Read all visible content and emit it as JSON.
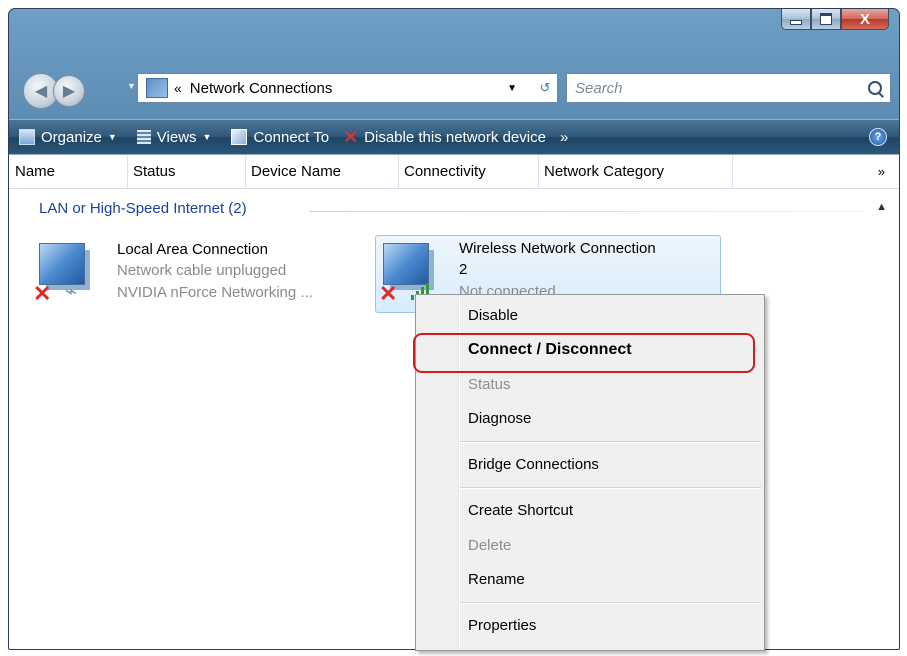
{
  "window": {
    "close_glyph": "X"
  },
  "address_bar": {
    "chevron": "«",
    "path": "Network Connections",
    "search_placeholder": "Search"
  },
  "toolbar": {
    "organize": "Organize",
    "views": "Views",
    "connect_to": "Connect To",
    "disable_device": "Disable this network device",
    "overflow": "»",
    "help": "?"
  },
  "columns": [
    "Name",
    "Status",
    "Device Name",
    "Connectivity",
    "Network Category"
  ],
  "columns_overflow": "»",
  "group": {
    "label": "LAN or High-Speed Internet (2)"
  },
  "connections": [
    {
      "name": "Local Area Connection",
      "status": "Network cable unplugged",
      "device": "NVIDIA nForce Networking ..."
    },
    {
      "name_line1": "Wireless Network Connection",
      "name_line2": "2",
      "status": "Not connected"
    }
  ],
  "context_menu": {
    "items": [
      {
        "label": "Disable",
        "enabled": true
      },
      {
        "label": "Connect / Disconnect",
        "enabled": true,
        "default": true
      },
      {
        "label": "Status",
        "enabled": false
      },
      {
        "label": "Diagnose",
        "enabled": true
      },
      {
        "label": "Bridge Connections",
        "enabled": true
      },
      {
        "label": "Create Shortcut",
        "enabled": true
      },
      {
        "label": "Delete",
        "enabled": false
      },
      {
        "label": "Rename",
        "enabled": true
      },
      {
        "label": "Properties",
        "enabled": true
      }
    ]
  },
  "colors": {
    "highlight_ring": "#cc2020",
    "group_header": "#1c3fa6"
  }
}
